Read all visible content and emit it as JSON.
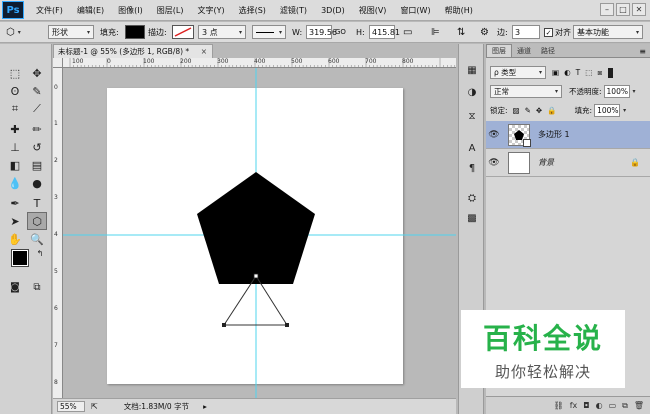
{
  "app": {
    "logo": "Ps",
    "menu": [
      "文件(F)",
      "编辑(E)",
      "图像(I)",
      "图层(L)",
      "文字(Y)",
      "选择(S)",
      "滤镜(T)",
      "3D(D)",
      "视图(V)",
      "窗口(W)",
      "帮助(H)"
    ],
    "window_controls": [
      "–",
      "□",
      "✕"
    ]
  },
  "options_bar": {
    "mode_value": "形状",
    "fill_label": "填充:",
    "stroke_label": "描边:",
    "stroke_width": "3 点",
    "w_label": "W:",
    "w_value": "319.56",
    "link_icon": "GO",
    "h_label": "H:",
    "h_value": "415.81",
    "sides_label": "边:",
    "sides_value": "3",
    "align_label": "对齐",
    "workspace": "基本功能"
  },
  "document": {
    "tab_title": "未标题-1 @ 55% (多边形 1, RGB/8) *",
    "tab_close": "×",
    "zoom": "55%",
    "doc_info": "文档:1.83M/0 字节",
    "ruler_top": [
      "100",
      "0",
      "100",
      "200",
      "300",
      "400",
      "500",
      "600",
      "700",
      "800"
    ],
    "ruler_left": [
      "0",
      "1",
      "2",
      "3",
      "4",
      "5",
      "6",
      "7",
      "8"
    ]
  },
  "layers_panel": {
    "tabs": [
      "图层",
      "通道",
      "路径"
    ],
    "kind_filter": "ρ 类型",
    "blend_mode": "正常",
    "opacity_label": "不透明度:",
    "opacity_value": "100%",
    "lock_label": "锁定:",
    "fill_label": "填充:",
    "fill_value": "100%",
    "layers": [
      {
        "name": "多边形 1",
        "selected": true
      },
      {
        "name": "背景",
        "selected": false
      }
    ],
    "bottom_icons": [
      "link-icon",
      "fx-icon",
      "mask-icon",
      "adjustment-icon",
      "group-icon",
      "new-layer-icon",
      "trash-icon"
    ]
  },
  "watermark": {
    "main": "百科全说",
    "sub": "助你轻松解决"
  },
  "colors": {
    "accent_selected": "#9fb1d6",
    "guide": "#4fd4ee",
    "watermark_green": "#27b24a"
  }
}
